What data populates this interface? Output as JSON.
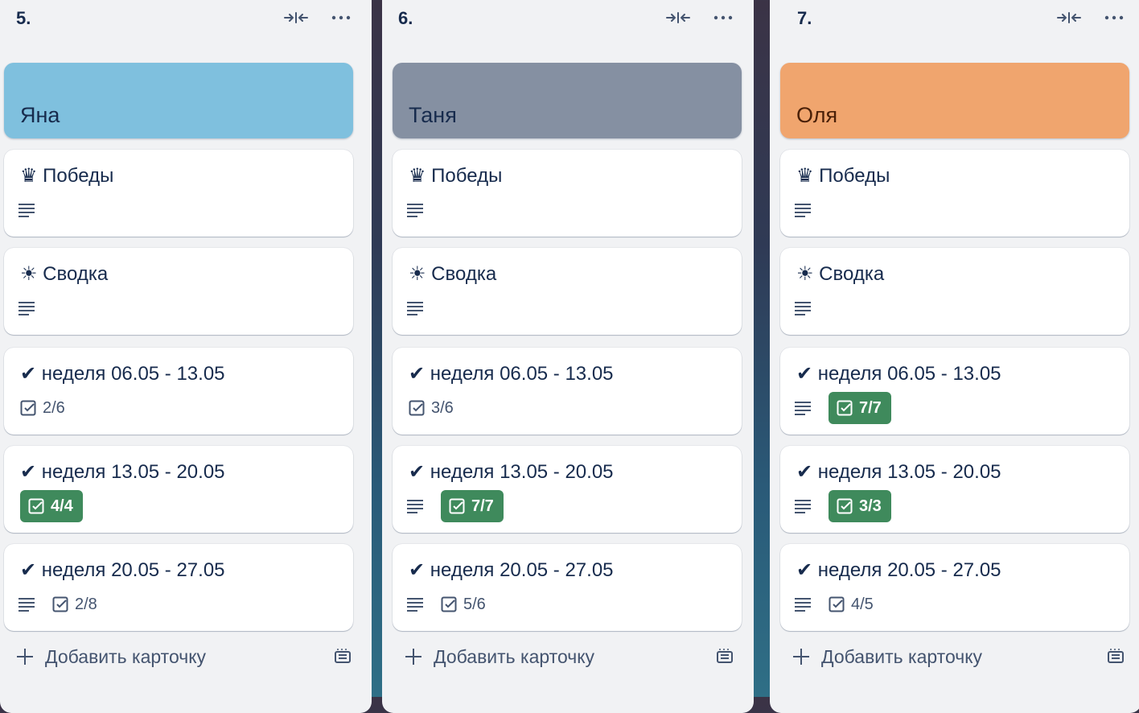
{
  "lists": [
    {
      "title": "5.",
      "cover": {
        "title": "Яна",
        "color": "#7fc0de"
      },
      "cards": [
        {
          "title": "♛ Победы",
          "desc": true
        },
        {
          "title": "☀ Сводка",
          "desc": true
        },
        {
          "title": "✔ неделя 06.05 - 13.05",
          "desc": false,
          "check": "2/6",
          "done": false
        },
        {
          "title": "✔ неделя 13.05 - 20.05",
          "desc": false,
          "check": "4/4",
          "done": true
        },
        {
          "title": "✔ неделя 20.05 - 27.05",
          "desc": true,
          "check": "2/8",
          "done": false
        }
      ],
      "add_label": "Добавить карточку"
    },
    {
      "title": "6.",
      "cover": {
        "title": "Таня",
        "color": "#8590a2"
      },
      "cards": [
        {
          "title": "♛ Победы",
          "desc": true
        },
        {
          "title": "☀ Сводка",
          "desc": true
        },
        {
          "title": "✔ неделя 06.05 - 13.05",
          "desc": false,
          "check": "3/6",
          "done": false
        },
        {
          "title": "✔ неделя 13.05 - 20.05",
          "desc": true,
          "check": "7/7",
          "done": true
        },
        {
          "title": "✔ неделя 20.05 - 27.05",
          "desc": true,
          "check": "5/6",
          "done": false
        }
      ],
      "add_label": "Добавить карточку"
    },
    {
      "title": "7.",
      "cover": {
        "title": "Оля",
        "color": "#f0a56e"
      },
      "cards": [
        {
          "title": "♛ Победы",
          "desc": true
        },
        {
          "title": "☀ Сводка",
          "desc": true
        },
        {
          "title": "✔ неделя 06.05 - 13.05",
          "desc": true,
          "check": "7/7",
          "done": true
        },
        {
          "title": "✔ неделя 13.05 - 20.05",
          "desc": true,
          "check": "3/3",
          "done": true
        },
        {
          "title": "✔ неделя 20.05 - 27.05",
          "desc": true,
          "check": "4/5",
          "done": false
        }
      ],
      "add_label": "Добавить карточку"
    }
  ],
  "icons": {
    "collapse": "collapse-arrows-icon",
    "more": "more-dots-icon",
    "description": "description-lines-icon",
    "checklist": "checklist-icon",
    "add": "plus-icon",
    "template": "card-template-icon"
  },
  "colors": {
    "done_badge": "#3f8a5c",
    "list_bg": "#f1f2f4",
    "text": "#172b4d"
  }
}
